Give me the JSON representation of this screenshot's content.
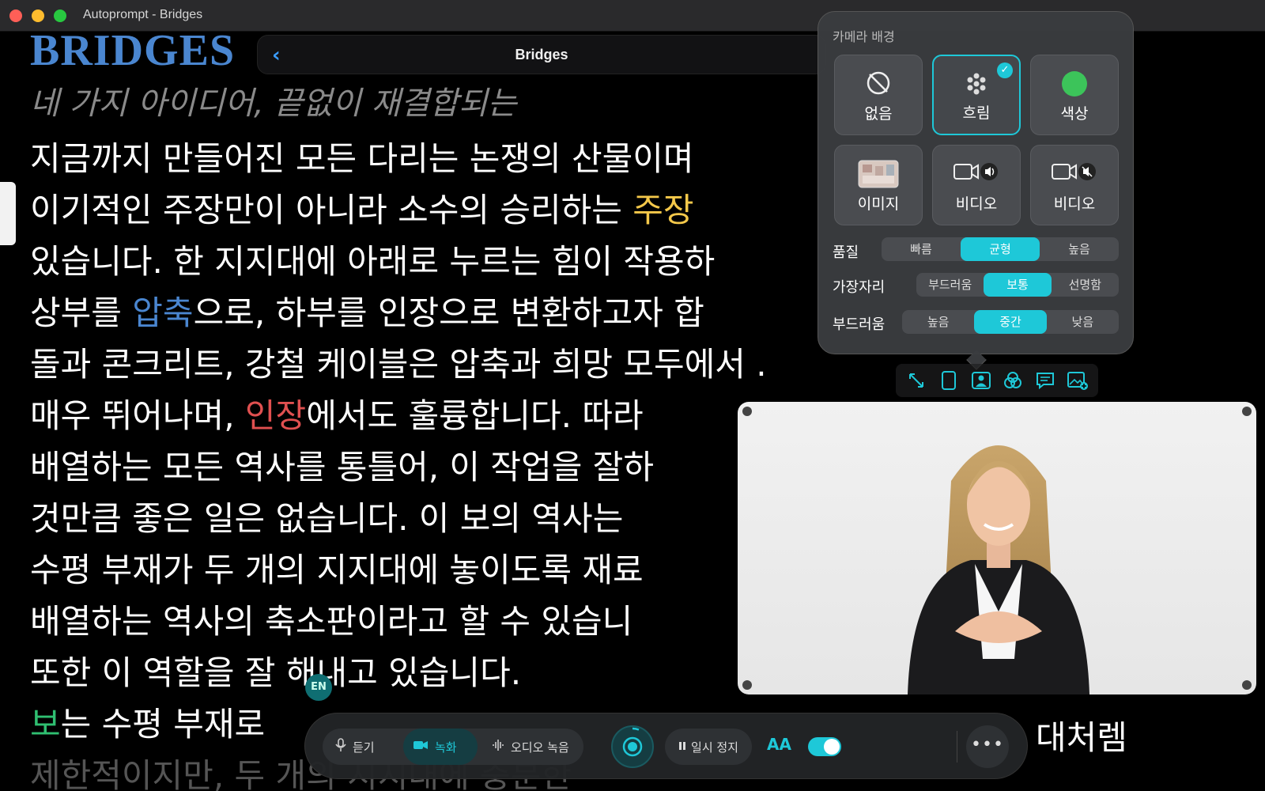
{
  "window": {
    "title": "Autoprompt - Bridges"
  },
  "nav": {
    "title": "Bridges"
  },
  "document": {
    "title": "BRIDGES",
    "subtitle": "네 가지 아이디어, 끝없이 재결합되는",
    "lines": [
      [
        "지금까지 만들어진 모든 다리는 논쟁의 산물이며",
        "",
        "",
        "",
        ""
      ],
      [
        "이기적인 주장만이 아니라 소수의 승리하는 ",
        "주장",
        "",
        "",
        ""
      ],
      [
        "있습니다. 한 지지대에 아래로 누르는 힘이 작용하",
        "",
        "",
        "",
        ""
      ],
      [
        "상부를 ",
        "압축",
        "으로, 하부를 인장으로 변환하고자 합",
        "",
        ""
      ],
      [
        "돌과 콘크리트, 강철 케이블은 압축과 희망 모두에서 .",
        "",
        "",
        "",
        ""
      ],
      [
        "매우 뛰어나며, ",
        "인장",
        "에서도 훌륭합니다. 따라",
        "",
        ""
      ],
      [
        "배열하는 모든 역사를 통틀어, 이 작업을 잘하",
        "",
        "",
        "",
        ""
      ],
      [
        "것만큼 좋은 일은 없습니다. 이 보의 역사는",
        "",
        "",
        "",
        ""
      ],
      [
        "수평 부재가 두 개의 지지대에 놓이도록 재료",
        "",
        "",
        "",
        ""
      ],
      [
        "배열하는 역사의 축소판이라고 할 수 있습니",
        "",
        "",
        "",
        ""
      ],
      [
        "또한 이 역할을 잘 해내고 있습니다.",
        "",
        "",
        "",
        ""
      ],
      [
        "보",
        "는 수평 부재로",
        "",
        "",
        ""
      ]
    ],
    "line13_tail": "제한적이지만, 두 개의 지지대에 충분한",
    "overflow_text": "대처렘"
  },
  "camera_popover": {
    "heading": "카메라 배경",
    "tiles": [
      {
        "label": "없음",
        "icon": "no-background-icon",
        "selected": false
      },
      {
        "label": "흐림",
        "icon": "blur-icon",
        "selected": true
      },
      {
        "label": "색상",
        "icon": "color-circle-icon",
        "selected": false,
        "color": "#3cc45a"
      },
      {
        "label": "이미지",
        "icon": "image-thumbnail",
        "selected": false
      },
      {
        "label": "비디오",
        "icon": "video-sound-icon",
        "selected": false
      },
      {
        "label": "비디오",
        "icon": "video-muted-icon",
        "selected": false
      }
    ],
    "quality": {
      "label": "품질",
      "options": [
        "빠름",
        "균형",
        "높음"
      ],
      "selected": "균형"
    },
    "edge": {
      "label": "가장자리",
      "options": [
        "부드러움",
        "보통",
        "선명함"
      ],
      "selected": "보통"
    },
    "smoothing": {
      "label": "부드러움",
      "options": [
        "높음",
        "중간",
        "낮음"
      ],
      "selected": "중간"
    }
  },
  "camera_toolbar": {
    "icons": [
      "resize-icon",
      "portrait-frame-icon",
      "person-background-icon",
      "overlap-circles-icon",
      "caption-icon",
      "image-add-icon"
    ]
  },
  "language_badge": "EN",
  "controls": {
    "listen": "듣기",
    "record": "녹화",
    "audio_record": "오디오 녹음",
    "pause": "일시 정지",
    "text_size": "AA",
    "toggle_on": true,
    "more": "•••"
  },
  "colors": {
    "accent": "#1ec8d8",
    "title_blue": "#4a86d0",
    "highlight_yellow": "#f4c84a",
    "highlight_red": "#e05050",
    "highlight_green": "#2fbf71"
  }
}
